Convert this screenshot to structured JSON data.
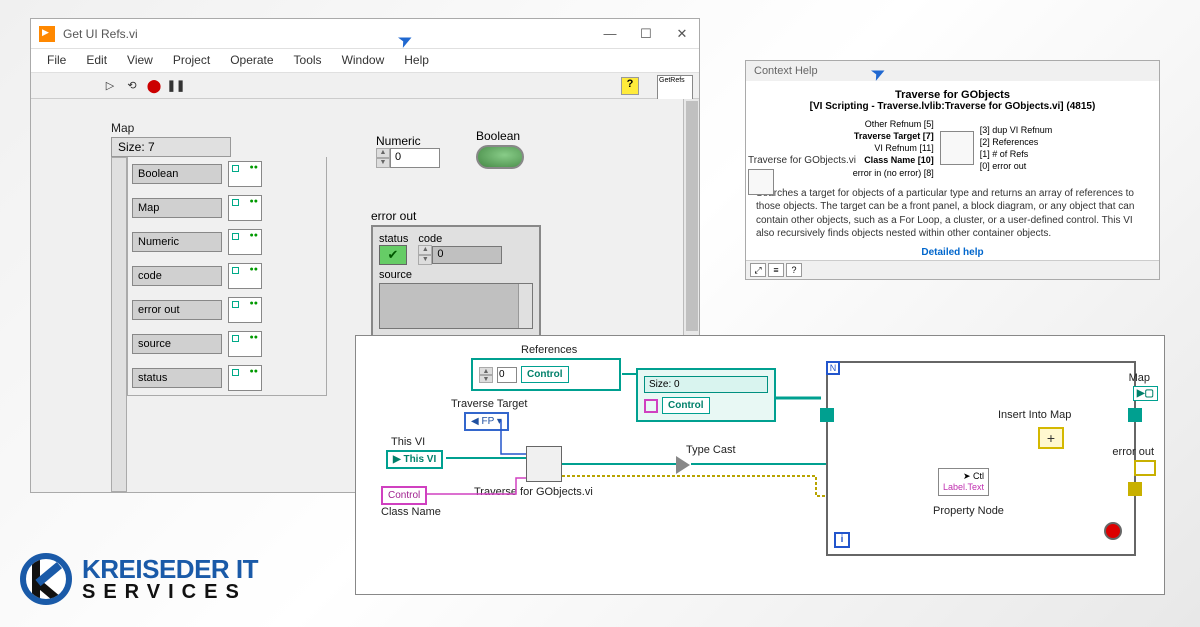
{
  "lv_window": {
    "title": "Get UI Refs.vi",
    "menus": [
      "File",
      "Edit",
      "View",
      "Project",
      "Operate",
      "Tools",
      "Window",
      "Help"
    ]
  },
  "panel": {
    "map": {
      "label": "Map",
      "size_text": "Size: 7",
      "keys": [
        "Boolean",
        "Map",
        "Numeric",
        "code",
        "error out",
        "source",
        "status"
      ]
    },
    "numeric": {
      "label": "Numeric",
      "value": "0"
    },
    "boolean": {
      "label": "Boolean"
    },
    "error": {
      "label": "error out",
      "status_label": "status",
      "code_label": "code",
      "code_value": "0",
      "source_label": "source"
    }
  },
  "context_help": {
    "title": "Context Help",
    "heading": "Traverse for GObjects",
    "sub": "[VI Scripting - Traverse.lvlib:Traverse for GObjects.vi] (4815)",
    "left_terms": [
      "Other Refnum [5]",
      "Traverse Target [7]",
      "VI Refnum [11]",
      "Class Name [10]",
      "error in (no error) [8]"
    ],
    "right_terms": [
      "[3] dup VI Refnum",
      "[2] References",
      "[1] # of Refs",
      "[0] error out"
    ],
    "desc": "Searches a target for objects of a particular type and returns an array of references to those objects. The target can be a front panel, a block diagram, or any object that can contain other objects, such as a For Loop, a cluster, or a user-defined control. This VI also recursively finds objects nested within other container objects.",
    "link": "Detailed help",
    "side_label": "Traverse for GObjects.vi"
  },
  "bd": {
    "references_label": "References",
    "traverse_target_label": "Traverse Target",
    "traverse_target_value": "FP",
    "this_vi_label": "This VI",
    "this_vi_value": "This VI",
    "control_const": "Control",
    "class_name_label": "Class Name",
    "traverse_vi_label": "Traverse for GObjects.vi",
    "ref_idx": "0",
    "ref_elem": "Control",
    "size0": "Size: 0",
    "cluster_elem": "Control",
    "type_cast": "Type Cast",
    "prop_ctrl": "Ctl",
    "prop_label": "Label.Text",
    "prop_node_lbl": "Property Node",
    "insert_label": "Insert Into Map",
    "map_out": "Map",
    "error_out": "error out"
  },
  "logo": {
    "top": "KREISEDER IT",
    "bot": "SERVICES"
  }
}
